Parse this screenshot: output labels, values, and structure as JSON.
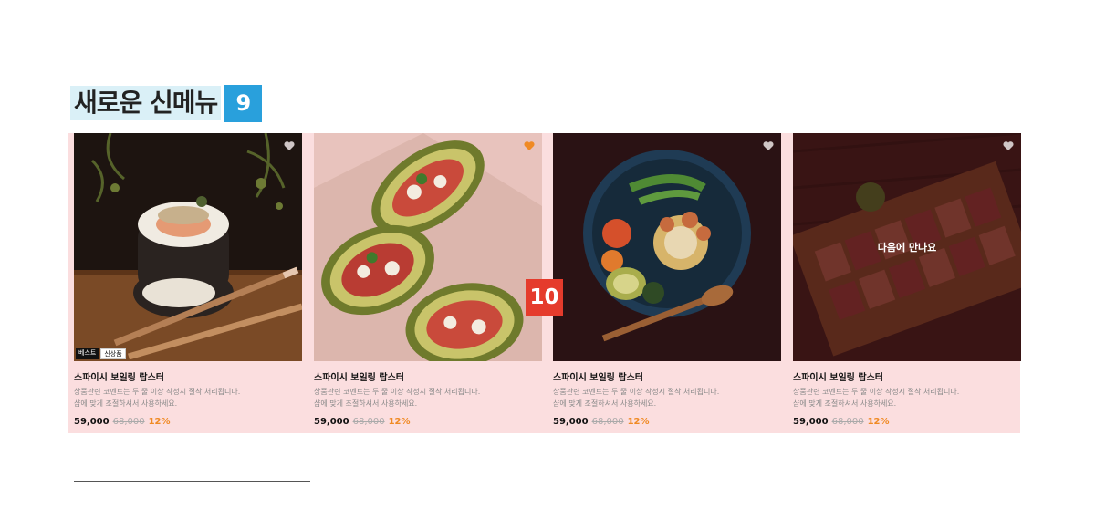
{
  "section": {
    "title": "새로운 신메뉴",
    "badge": "9"
  },
  "marker": "10",
  "cards": [
    {
      "name": "스파이시 보일링 랍스터",
      "desc_line1": "상품관련 코멘트는 두 줄 이상 작성시 절삭 처리됩니다.",
      "desc_line2": "샵에 맞게 조절하셔서 사용하세요.",
      "price": "59,000",
      "original_price": "68,000",
      "discount": "12%",
      "liked": false,
      "badges": [
        "베스트",
        "신상품"
      ],
      "image": "sushi-roll-photo"
    },
    {
      "name": "스파이시 보일링 랍스터",
      "desc_line1": "상품관련 코멘트는 두 줄 이상 작성시 절삭 처리됩니다.",
      "desc_line2": "샵에 맞게 조절하셔서 사용하세요.",
      "price": "59,000",
      "original_price": "68,000",
      "discount": "12%",
      "liked": true,
      "image": "stuffed-avocado-photo"
    },
    {
      "name": "스파이시 보일링 랍스터",
      "desc_line1": "상품관련 코멘트는 두 줄 이상 작성시 절삭 처리됩니다.",
      "desc_line2": "샵에 맞게 조절하셔서 사용하세요.",
      "price": "59,000",
      "original_price": "68,000",
      "discount": "12%",
      "liked": false,
      "image": "salad-bowl-photo"
    },
    {
      "name": "스파이시 보일링 랍스터",
      "desc_line1": "상품관련 코멘트는 두 줄 이상 작성시 절삭 처리됩니다.",
      "desc_line2": "샵에 맞게 조절하셔서 사용하세요.",
      "price": "59,000",
      "original_price": "68,000",
      "discount": "12%",
      "liked": false,
      "hover_label": "다음에 만나요",
      "image": "sushi-platter-photo"
    }
  ],
  "colors": {
    "title_highlight": "#daf0f7",
    "badge_blue": "#29a0dc",
    "marker_red": "#e53b2c",
    "card_bg": "#fbdedf",
    "discount": "#f08a24",
    "heart_active": "#f08a24",
    "heart_inactive": "#cfc6c6"
  },
  "carousel": {
    "progress": 0.25
  }
}
